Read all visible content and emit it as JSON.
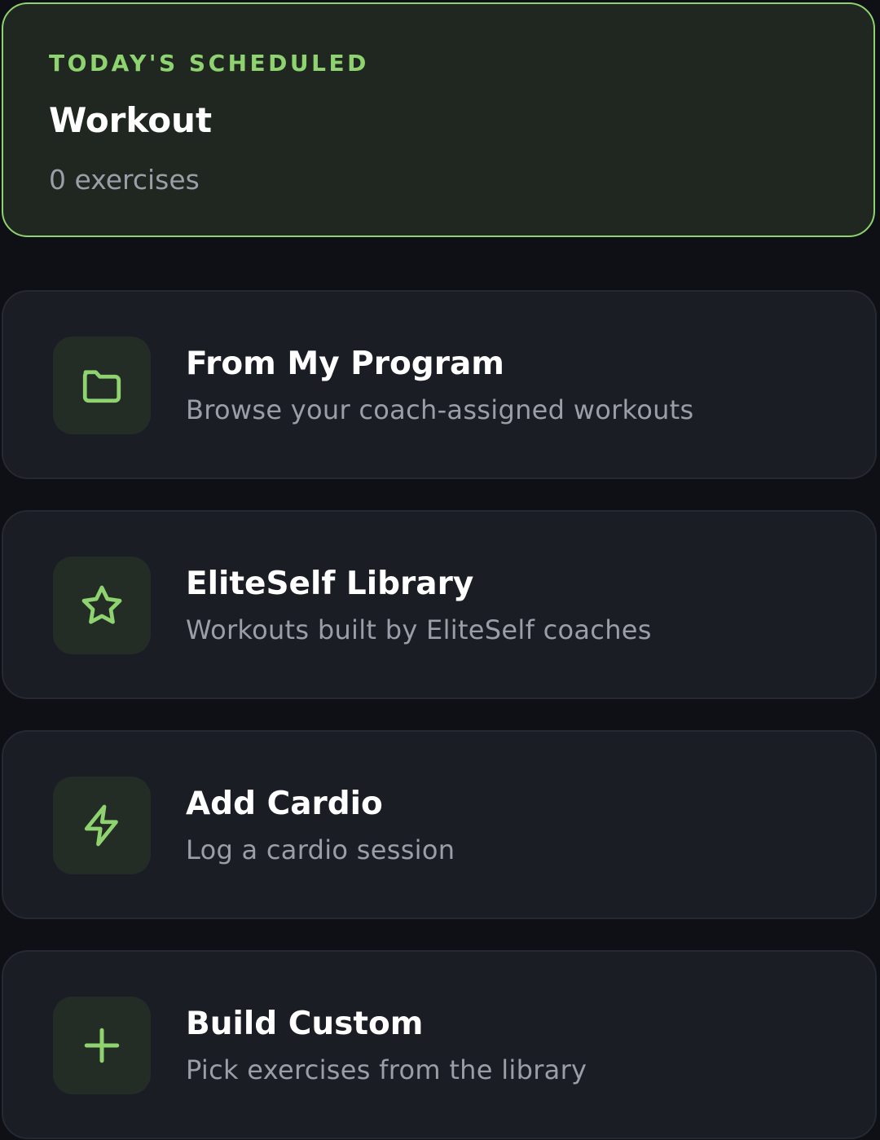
{
  "scheduled": {
    "eyebrow": "TODAY'S SCHEDULED",
    "title": "Workout",
    "exercise_count": "0 exercises"
  },
  "colors": {
    "accent": "#8ed36f",
    "background": "#0e1015",
    "card": "#1a1d24",
    "scheduled_card": "#1f2720",
    "icon_tile": "#242c26",
    "muted_text": "#9a9ea6"
  },
  "options": [
    {
      "icon": "folder-icon",
      "title": "From My Program",
      "subtitle": "Browse your coach-assigned workouts"
    },
    {
      "icon": "star-icon",
      "title": "EliteSelf Library",
      "subtitle": "Workouts built by EliteSelf coaches"
    },
    {
      "icon": "lightning-icon",
      "title": "Add Cardio",
      "subtitle": "Log a cardio session"
    },
    {
      "icon": "plus-icon",
      "title": "Build Custom",
      "subtitle": "Pick exercises from the library"
    }
  ]
}
